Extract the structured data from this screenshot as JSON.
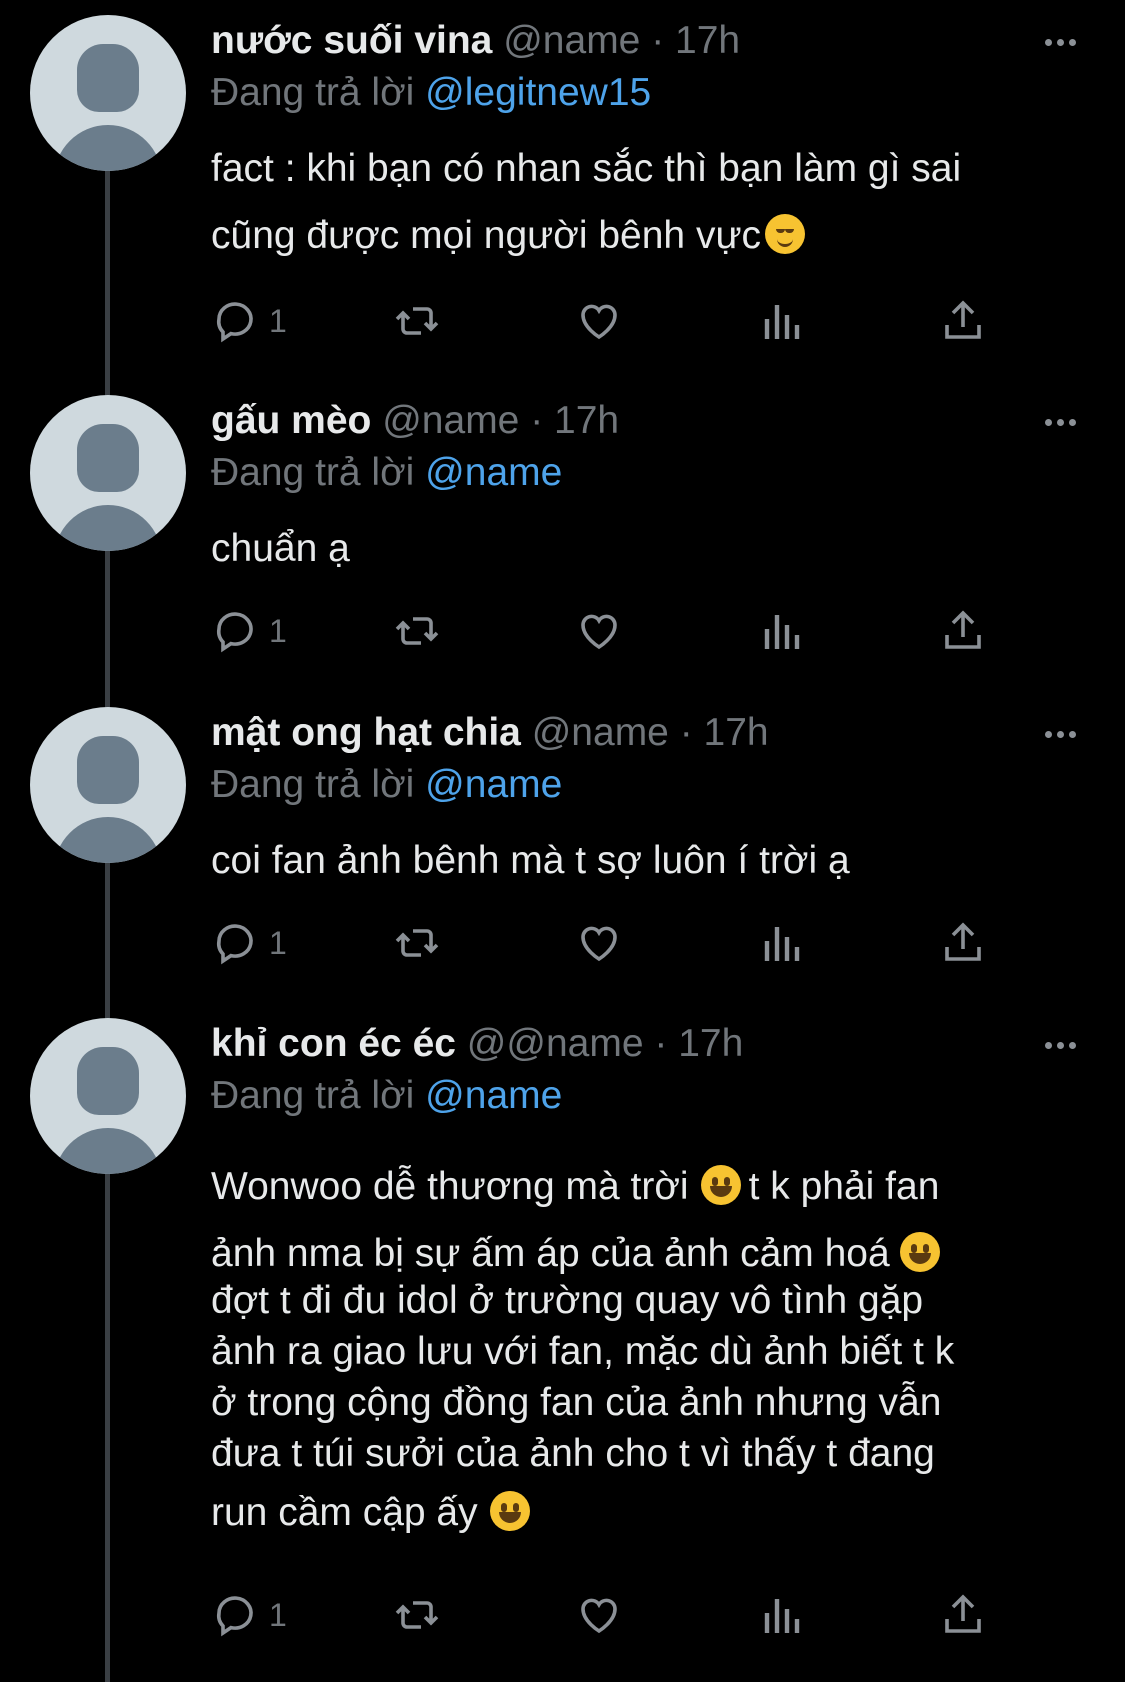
{
  "colors": {
    "background": "#000000",
    "name": "#e7e9ea",
    "muted": "#71767b",
    "mention": "#4ea3ea"
  },
  "tweets": [
    {
      "name": "nước suối vina",
      "meta": "@name · 17h",
      "reply_prefix": "Đang trả lời",
      "reply_to": "@legitnew15",
      "lines": [
        "fact : khi bạn có nhan sắc thì bạn làm gì sai",
        "cũng được mọi người bênh vực"
      ],
      "reply_count": "1"
    },
    {
      "name": "gấu mèo",
      "meta": "@name · 17h",
      "reply_prefix": "Đang trả lời",
      "reply_to": "@name",
      "lines": [
        "chuẩn ạ"
      ],
      "reply_count": "1"
    },
    {
      "name": "mật ong hạt chia",
      "meta": "@name · 17h",
      "reply_prefix": "Đang trả lời",
      "reply_to": "@name",
      "lines": [
        "coi fan ảnh bênh mà t sợ luôn í trời ạ"
      ],
      "reply_count": "1"
    },
    {
      "name": "khỉ con éc éc",
      "meta": "@@name · 17h",
      "reply_prefix": "Đang trả lời",
      "reply_to": "@name",
      "lines": [
        "Wonwoo dễ thương mà trời",
        "t k phải fan",
        "ảnh nma bị sự ấm áp của ảnh cảm hoá",
        "đợt t đi đu idol ở trường quay vô tình gặp",
        "ảnh ra giao lưu với fan, mặc dù ảnh biết t k",
        "ở trong cộng đồng fan của ảnh nhưng vẫn",
        "đưa t túi sưởi của ảnh cho t vì thấy t đang",
        "run cầm cập ấy"
      ],
      "reply_count": "1"
    }
  ],
  "icons": [
    "reply-icon",
    "retweet-icon",
    "like-icon",
    "views-icon",
    "share-icon",
    "more-icon",
    "smiling-face-emoji",
    "relieved-face-emoji"
  ]
}
